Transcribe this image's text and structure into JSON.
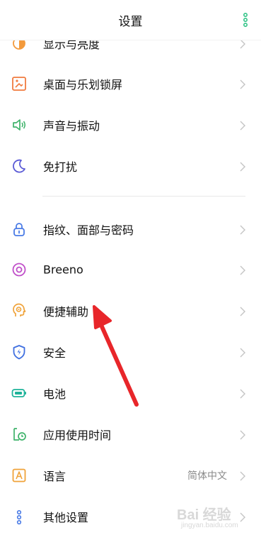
{
  "header": {
    "title": "设置",
    "more_icon": "vertical-dots-icon"
  },
  "colors": {
    "accent": "#33c488",
    "arrow": "#e8262a"
  },
  "items": [
    {
      "label": "显示与亮度",
      "icon": "display-brightness-icon"
    },
    {
      "label": "桌面与乐划锁屏",
      "icon": "wallpaper-icon"
    },
    {
      "label": "声音与振动",
      "icon": "speaker-icon"
    },
    {
      "label": "免打扰",
      "icon": "moon-icon"
    },
    {
      "label": "指纹、面部与密码",
      "icon": "lock-icon"
    },
    {
      "label": "Breeno",
      "icon": "breeno-icon"
    },
    {
      "label": "便捷辅助",
      "icon": "accessibility-icon"
    },
    {
      "label": "安全",
      "icon": "shield-icon"
    },
    {
      "label": "电池",
      "icon": "battery-icon"
    },
    {
      "label": "应用使用时间",
      "icon": "app-timer-icon"
    },
    {
      "label": "语言",
      "value": "简体中文",
      "icon": "language-icon"
    },
    {
      "label": "其他设置",
      "icon": "other-settings-icon"
    }
  ],
  "watermark": {
    "line1": "Bai 经验",
    "line2": "jingyan.baidu.com"
  }
}
